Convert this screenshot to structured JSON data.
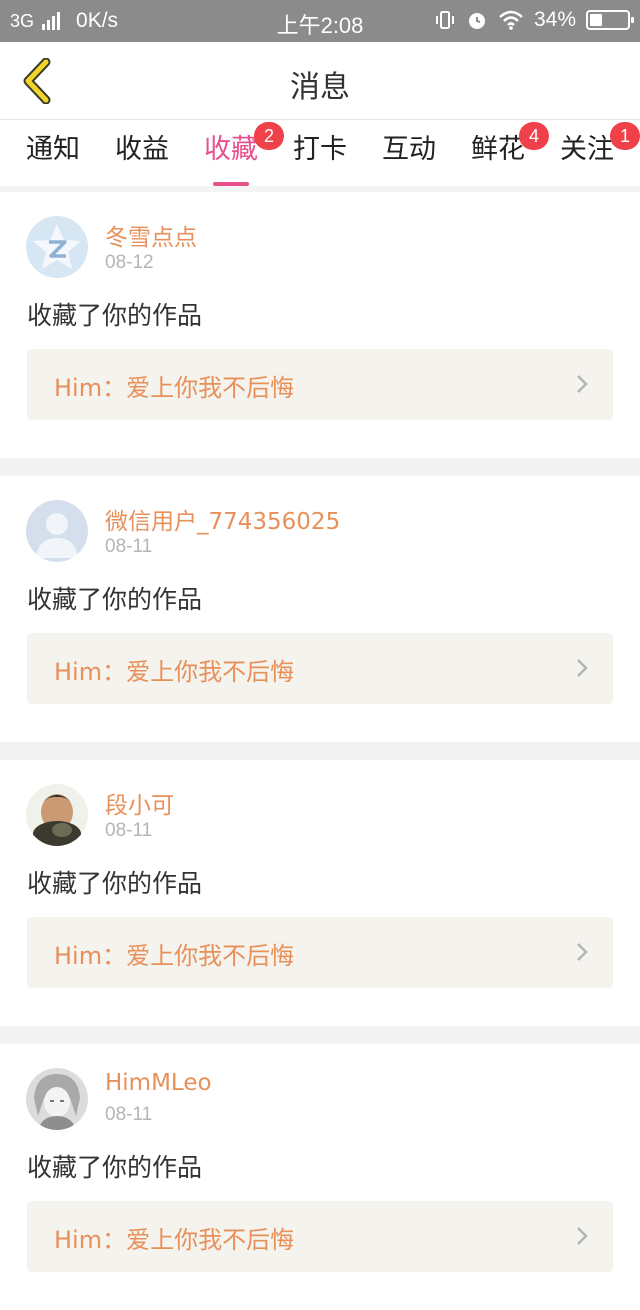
{
  "status_bar": {
    "network": "3G",
    "speed": "0K/s",
    "time": "上午2:08",
    "battery_percent": "34%",
    "battery_level": 0.34
  },
  "header": {
    "title": "消息",
    "back_icon": "chevron-left-icon"
  },
  "tabs": [
    {
      "label": "通知",
      "badge": ""
    },
    {
      "label": "收益",
      "badge": ""
    },
    {
      "label": "收藏",
      "badge": "2",
      "active": true
    },
    {
      "label": "打卡",
      "badge": ""
    },
    {
      "label": "互动",
      "badge": ""
    },
    {
      "label": "鲜花",
      "badge": "4"
    },
    {
      "label": "关注",
      "badge": "1"
    }
  ],
  "colors": {
    "accent": "#e7518b",
    "username": "#e8905a",
    "badge": "#f0404a",
    "back_arrow": "#f2d52a"
  },
  "notifications": [
    {
      "username": "冬雪点点",
      "date": "08-12",
      "action": "收藏了你的作品",
      "work_title": "Him：爱上你我不后悔"
    },
    {
      "username": "微信用户_774356025",
      "date": "08-11",
      "action": "收藏了你的作品",
      "work_title": "Him：爱上你我不后悔"
    },
    {
      "username": "段小可",
      "date": "08-11",
      "action": "收藏了你的作品",
      "work_title": "Him：爱上你我不后悔"
    },
    {
      "username": "HimMLeo",
      "date": "08-11",
      "action": "收藏了你的作品",
      "work_title": "Him：爱上你我不后悔"
    }
  ]
}
